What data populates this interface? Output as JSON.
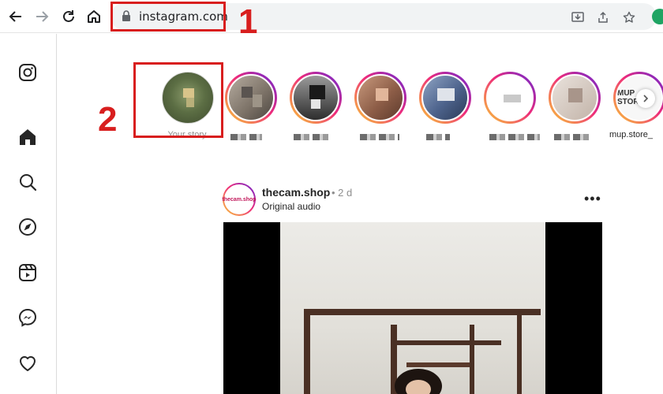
{
  "browser": {
    "url": "instagram.com"
  },
  "annotations": {
    "first": "1",
    "second": "2"
  },
  "rail": {
    "items": [
      {
        "icon": "instagram-logo-icon"
      },
      {
        "icon": "home-icon"
      },
      {
        "icon": "search-icon"
      },
      {
        "icon": "explore-icon"
      },
      {
        "icon": "reels-icon"
      },
      {
        "icon": "messenger-icon"
      },
      {
        "icon": "heart-icon"
      }
    ]
  },
  "stories": {
    "own_label": "Your story",
    "last_label": "mup.store_",
    "last_avatar_text": "MUP STORE"
  },
  "post": {
    "username": "thecam.shop",
    "time": "• 2 d",
    "subtitle": "Original audio",
    "avatar_text": "thecam.shop",
    "more_label": "•••"
  },
  "colors": {
    "annotation": "#d81e1e",
    "story_ring_start": "#f9ce34",
    "story_ring_mid": "#ee2a7b",
    "story_ring_end": "#6228d7"
  }
}
